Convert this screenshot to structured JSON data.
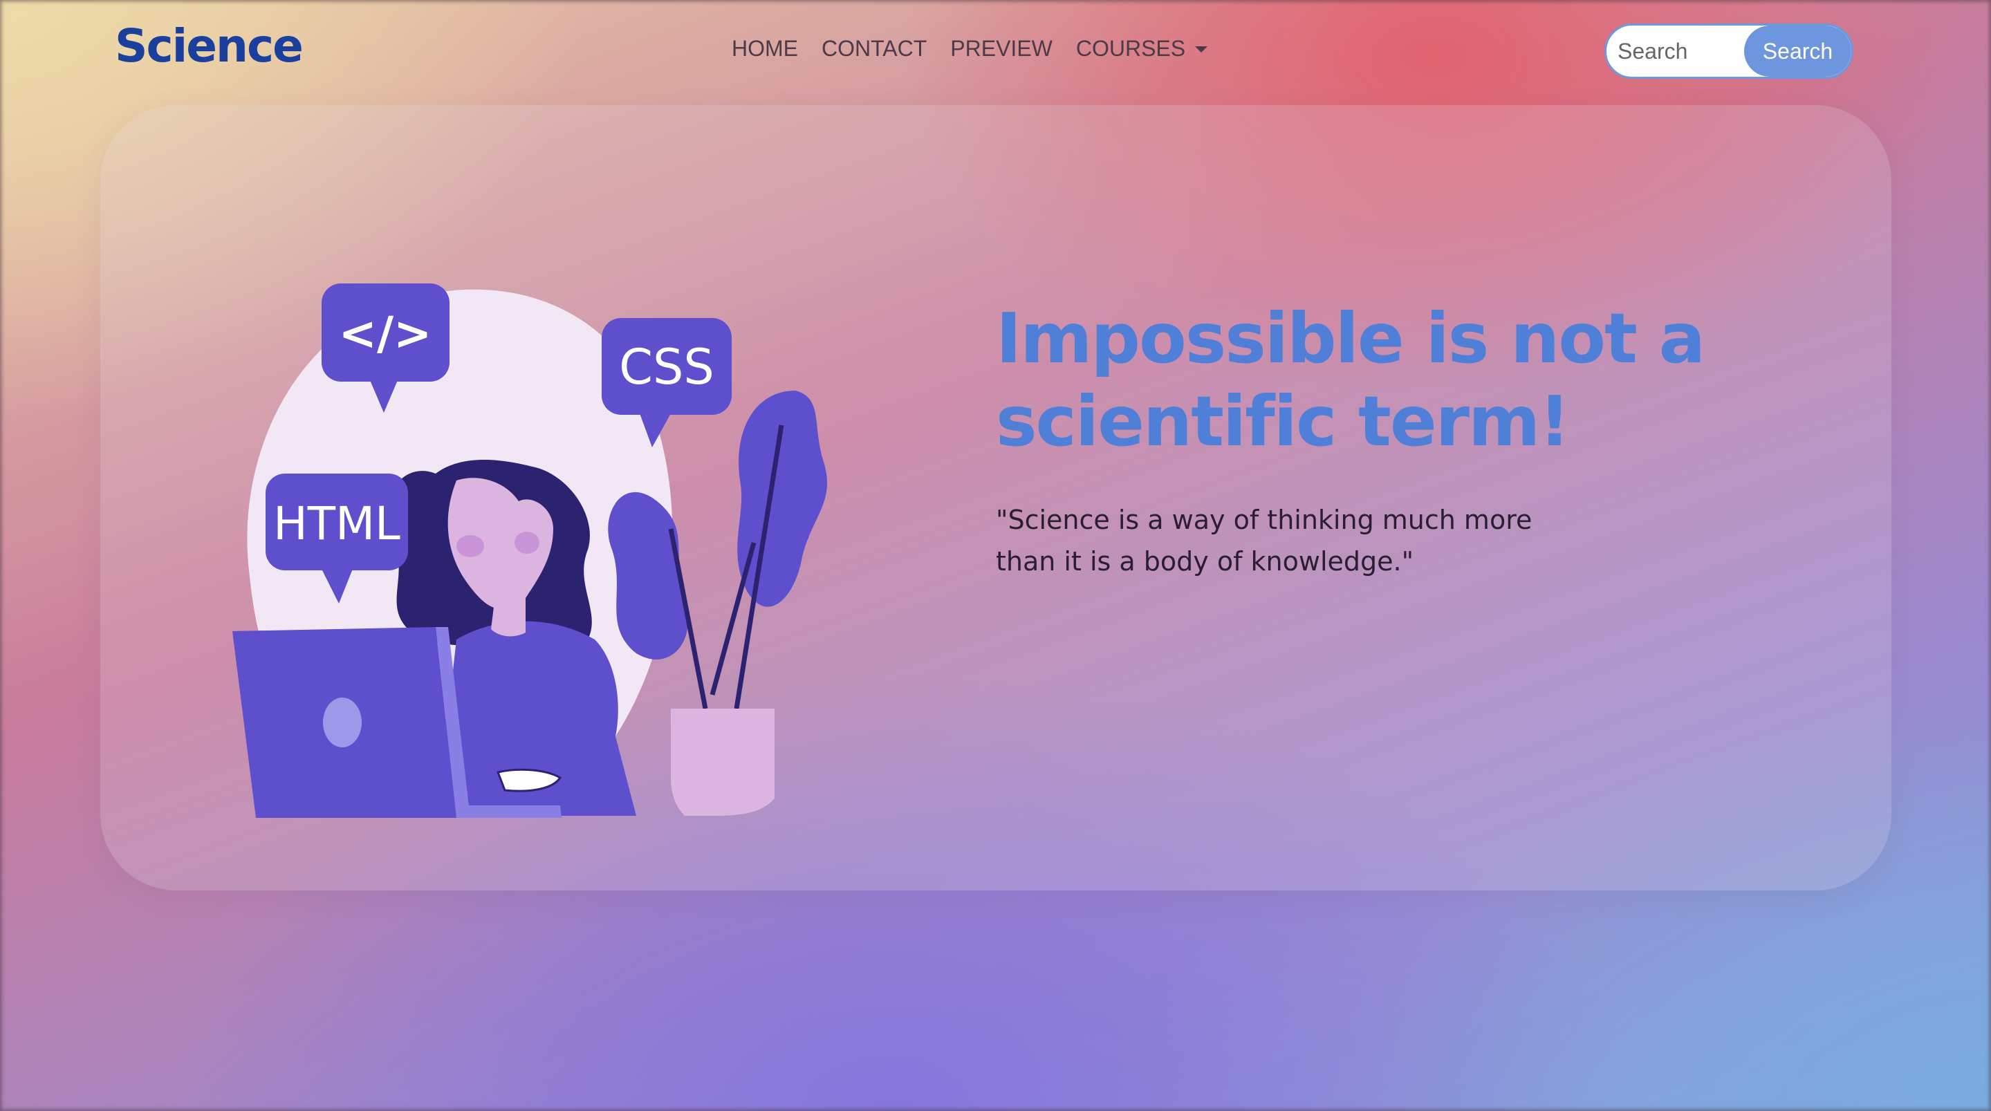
{
  "navbar": {
    "brand": "Science",
    "menu": [
      {
        "label": "HOME"
      },
      {
        "label": "CONTACT"
      },
      {
        "label": "PREVIEW"
      },
      {
        "label": "COURSES"
      }
    ],
    "search": {
      "placeholder": "Search",
      "button_label": "Search"
    }
  },
  "hero": {
    "headline": "Impossible is not a scientific term!",
    "quote": "\"Science is a way of thinking much more than it is a body of knowledge.\"",
    "illustration": {
      "bubble_code": "</>",
      "bubble_css": "CSS",
      "bubble_html": "HTML"
    }
  },
  "colors": {
    "brand": "#1a3f9c",
    "headline": "#4f7fd6",
    "accent_button": "#6d96df",
    "illustration_purple": "#5a4fcf"
  }
}
